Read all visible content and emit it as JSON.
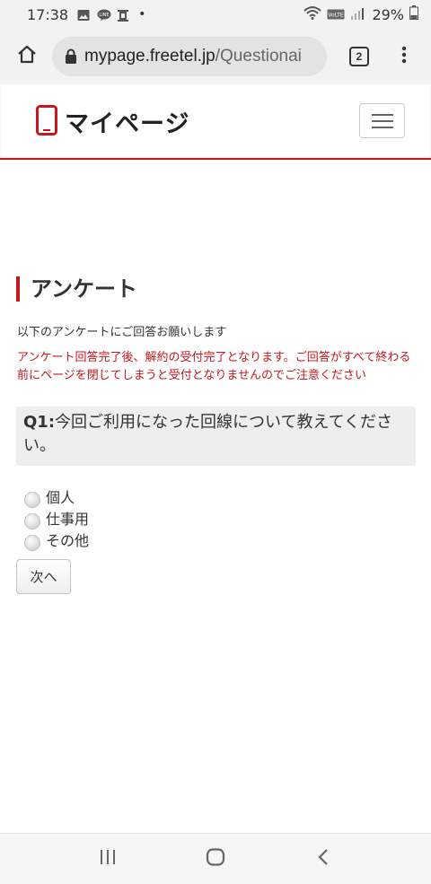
{
  "status_bar": {
    "time": "17:38",
    "battery_percent": "29%",
    "icons": [
      "image-icon",
      "line-icon",
      "alarm-icon",
      "wifi-icon",
      "volte-icon",
      "signal-icon",
      "battery-icon"
    ]
  },
  "browser": {
    "url_domain": "mypage.freetel.jp",
    "url_path": "/Questionai",
    "tab_count": "2"
  },
  "site": {
    "logo_text": "マイページ",
    "accent_color": "#c8161d"
  },
  "main": {
    "heading": "アンケート",
    "intro": "以下のアンケートにご回答お願いします",
    "warning": "アンケート回答完了後、解約の受付完了となります。ご回答がすべて終わる前にページを閉じてしまうと受付となりませんのでご注意ください",
    "question": {
      "number": "Q1:",
      "text": "今回ご利用になった回線について教えてください。"
    },
    "options": [
      "個人",
      "仕事用",
      "その他"
    ],
    "next_label": "次へ"
  },
  "nav_bar": {
    "icons": [
      "recent-apps-icon",
      "home-icon",
      "back-icon"
    ]
  }
}
